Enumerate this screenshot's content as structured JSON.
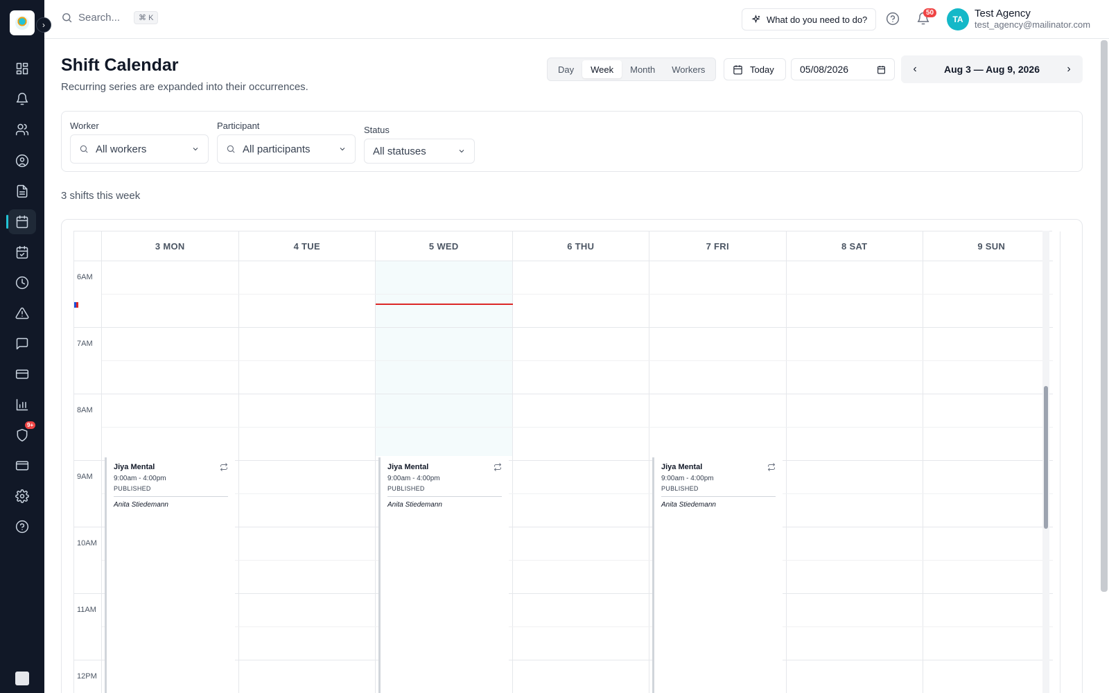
{
  "app": {
    "logo_alt": "My Agency"
  },
  "sidebar": {
    "items": [
      {
        "icon": "dashboard-icon"
      },
      {
        "icon": "bell-icon"
      },
      {
        "icon": "users-icon"
      },
      {
        "icon": "user-circle-icon"
      },
      {
        "icon": "document-icon"
      },
      {
        "icon": "calendar-icon",
        "active": true
      },
      {
        "icon": "calendar-check-icon"
      },
      {
        "icon": "clock-icon"
      },
      {
        "icon": "alert-triangle-icon"
      },
      {
        "icon": "message-icon"
      },
      {
        "icon": "credit-card-icon"
      },
      {
        "icon": "bar-chart-icon"
      },
      {
        "icon": "shield-icon",
        "badge": "9+"
      },
      {
        "icon": "wallet-icon"
      },
      {
        "icon": "settings-icon"
      },
      {
        "icon": "help-icon"
      }
    ]
  },
  "topbar": {
    "search_placeholder": "Search...",
    "shortcut": "⌘ K",
    "ask_label": "What do you need to do?",
    "notification_count": "50",
    "user": {
      "initials": "TA",
      "name": "Test Agency",
      "email": "test_agency@mailinator.com"
    }
  },
  "header": {
    "title": "Shift Calendar",
    "subtitle": "Recurring series are expanded into their occurrences.",
    "view_tabs": [
      "Day",
      "Week",
      "Month",
      "Workers"
    ],
    "active_view": "Week",
    "today_label": "Today",
    "date_value": "05/08/2026",
    "range_label": "Aug 3 — Aug 9, 2026"
  },
  "filters": {
    "worker_label": "Worker",
    "worker_value": "All workers",
    "participant_label": "Participant",
    "participant_value": "All participants",
    "status_label": "Status",
    "status_value": "All statuses"
  },
  "summary": {
    "shift_count_text": "3 shifts this week"
  },
  "calendar": {
    "days": [
      "3 MON",
      "4 TUE",
      "5 WED",
      "6 THU",
      "7 FRI",
      "8 SAT",
      "9 SUN"
    ],
    "today_index": 2,
    "hours": [
      "6AM",
      "7AM",
      "8AM",
      "9AM",
      "10AM",
      "11AM",
      "12PM"
    ],
    "shifts": [
      {
        "day_index": 0,
        "title": "Jiya Mental",
        "time": "9:00am - 4:00pm",
        "status": "PUBLISHED",
        "worker": "Anita Stiedemann"
      },
      {
        "day_index": 2,
        "title": "Jiya Mental",
        "time": "9:00am - 4:00pm",
        "status": "PUBLISHED",
        "worker": "Anita Stiedemann"
      },
      {
        "day_index": 4,
        "title": "Jiya Mental",
        "time": "9:00am - 4:00pm",
        "status": "PUBLISHED",
        "worker": "Anita Stiedemann"
      }
    ]
  },
  "colors": {
    "accent": "#14b8c8",
    "sidebar_bg": "#111827",
    "now_line": "#dc2626",
    "badge": "#ef4444"
  }
}
